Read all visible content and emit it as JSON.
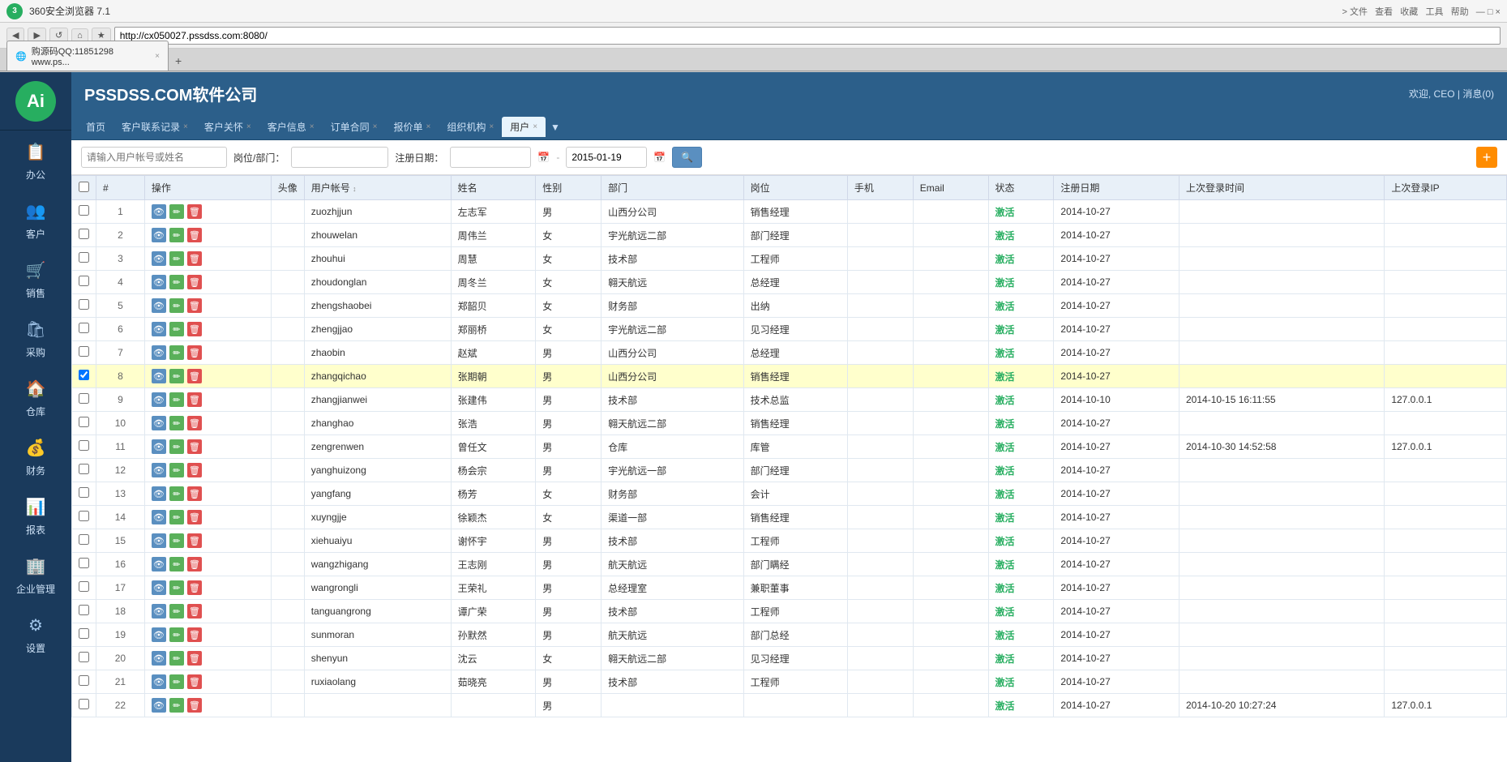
{
  "browser": {
    "title": "360安全浏览器 7.1",
    "tab_label": "购源码QQ:11851298 www.ps...",
    "address": "http://cx050027.pssdss.com:8080/",
    "nav_buttons": [
      "◀",
      "▶",
      "↺",
      "🏠",
      "★"
    ]
  },
  "header": {
    "company": "PSSDSS.COM软件公司",
    "welcome": "欢迎, CEO | 消息(0)"
  },
  "nav_tabs": [
    {
      "label": "首页",
      "closable": false
    },
    {
      "label": "客户联系记录",
      "closable": true
    },
    {
      "label": "客户关怀",
      "closable": true
    },
    {
      "label": "客户信息",
      "closable": true
    },
    {
      "label": "订单合同",
      "closable": true
    },
    {
      "label": "报价单",
      "closable": true
    },
    {
      "label": "组织机构",
      "closable": true
    },
    {
      "label": "用户",
      "closable": true,
      "active": true
    }
  ],
  "filters": {
    "search_placeholder": "请输入用户帐号或姓名",
    "position_label": "岗位/部门：",
    "position_placeholder": "",
    "reg_date_label": "注册日期：",
    "date_from": "",
    "date_to": "2015-01-19",
    "search_btn": "🔍",
    "add_btn": "+"
  },
  "table": {
    "columns": [
      "",
      "#",
      "操作",
      "头像",
      "用户帐号 ↕",
      "姓名",
      "性别",
      "部门",
      "岗位",
      "手机",
      "Email",
      "状态",
      "注册日期",
      "上次登录时间",
      "上次登录IP"
    ],
    "rows": [
      {
        "num": 1,
        "checked": false,
        "username": "zuozhjjun",
        "name": "左志军",
        "gender": "男",
        "dept": "山西分公司",
        "pos": "销售经理",
        "mobile": "",
        "email": "",
        "status": "激活",
        "reg_date": "2014-10-27",
        "last_login": "",
        "last_ip": "",
        "highlighted": false
      },
      {
        "num": 2,
        "checked": false,
        "username": "zhouwelan",
        "name": "周伟兰",
        "gender": "女",
        "dept": "宇光航远二部",
        "pos": "部门经理",
        "mobile": "",
        "email": "",
        "status": "激活",
        "reg_date": "2014-10-27",
        "last_login": "",
        "last_ip": "",
        "highlighted": false
      },
      {
        "num": 3,
        "checked": false,
        "username": "zhouhui",
        "name": "周慧",
        "gender": "女",
        "dept": "技术部",
        "pos": "工程师",
        "mobile": "",
        "email": "",
        "status": "激活",
        "reg_date": "2014-10-27",
        "last_login": "",
        "last_ip": "",
        "highlighted": false
      },
      {
        "num": 4,
        "checked": false,
        "username": "zhoudonglan",
        "name": "周冬兰",
        "gender": "女",
        "dept": "翱天航远",
        "pos": "总经理",
        "mobile": "",
        "email": "",
        "status": "激活",
        "reg_date": "2014-10-27",
        "last_login": "",
        "last_ip": "",
        "highlighted": false
      },
      {
        "num": 5,
        "checked": false,
        "username": "zhengshaobei",
        "name": "郑韶贝",
        "gender": "女",
        "dept": "财务部",
        "pos": "出纳",
        "mobile": "",
        "email": "",
        "status": "激活",
        "reg_date": "2014-10-27",
        "last_login": "",
        "last_ip": "",
        "highlighted": false
      },
      {
        "num": 6,
        "checked": false,
        "username": "zhengjjao",
        "name": "郑丽桥",
        "gender": "女",
        "dept": "宇光航远二部",
        "pos": "见习经理",
        "mobile": "",
        "email": "",
        "status": "激活",
        "reg_date": "2014-10-27",
        "last_login": "",
        "last_ip": "",
        "highlighted": false
      },
      {
        "num": 7,
        "checked": false,
        "username": "zhaobin",
        "name": "赵斌",
        "gender": "男",
        "dept": "山西分公司",
        "pos": "总经理",
        "mobile": "",
        "email": "",
        "status": "激活",
        "reg_date": "2014-10-27",
        "last_login": "",
        "last_ip": "",
        "highlighted": false
      },
      {
        "num": 8,
        "checked": true,
        "username": "zhangqichao",
        "name": "张期朝",
        "gender": "男",
        "dept": "山西分公司",
        "pos": "销售经理",
        "mobile": "",
        "email": "",
        "status": "激活",
        "reg_date": "2014-10-27",
        "last_login": "",
        "last_ip": "",
        "highlighted": true
      },
      {
        "num": 9,
        "checked": false,
        "username": "zhangjianwei",
        "name": "张建伟",
        "gender": "男",
        "dept": "技术部",
        "pos": "技术总监",
        "mobile": "",
        "email": "",
        "status": "激活",
        "reg_date": "2014-10-10",
        "last_login": "2014-10-15 16:11:55",
        "last_ip": "127.0.0.1",
        "highlighted": false
      },
      {
        "num": 10,
        "checked": false,
        "username": "zhanghao",
        "name": "张浩",
        "gender": "男",
        "dept": "翱天航远二部",
        "pos": "销售经理",
        "mobile": "",
        "email": "",
        "status": "激活",
        "reg_date": "2014-10-27",
        "last_login": "",
        "last_ip": "",
        "highlighted": false
      },
      {
        "num": 11,
        "checked": false,
        "username": "zengrenwen",
        "name": "曾任文",
        "gender": "男",
        "dept": "仓库",
        "pos": "库管",
        "mobile": "",
        "email": "",
        "status": "激活",
        "reg_date": "2014-10-27",
        "last_login": "2014-10-30 14:52:58",
        "last_ip": "127.0.0.1",
        "highlighted": false
      },
      {
        "num": 12,
        "checked": false,
        "username": "yanghuizong",
        "name": "杨会宗",
        "gender": "男",
        "dept": "宇光航远一部",
        "pos": "部门经理",
        "mobile": "",
        "email": "",
        "status": "激活",
        "reg_date": "2014-10-27",
        "last_login": "",
        "last_ip": "",
        "highlighted": false
      },
      {
        "num": 13,
        "checked": false,
        "username": "yangfang",
        "name": "杨芳",
        "gender": "女",
        "dept": "财务部",
        "pos": "会计",
        "mobile": "",
        "email": "",
        "status": "激活",
        "reg_date": "2014-10-27",
        "last_login": "",
        "last_ip": "",
        "highlighted": false
      },
      {
        "num": 14,
        "checked": false,
        "username": "xuyngjje",
        "name": "徐颖杰",
        "gender": "女",
        "dept": "渠道一部",
        "pos": "销售经理",
        "mobile": "",
        "email": "",
        "status": "激活",
        "reg_date": "2014-10-27",
        "last_login": "",
        "last_ip": "",
        "highlighted": false
      },
      {
        "num": 15,
        "checked": false,
        "username": "xiehuaiyu",
        "name": "谢怀宇",
        "gender": "男",
        "dept": "技术部",
        "pos": "工程师",
        "mobile": "",
        "email": "",
        "status": "激活",
        "reg_date": "2014-10-27",
        "last_login": "",
        "last_ip": "",
        "highlighted": false
      },
      {
        "num": 16,
        "checked": false,
        "username": "wangzhigang",
        "name": "王志刚",
        "gender": "男",
        "dept": "航天航远",
        "pos": "部门瞒经",
        "mobile": "",
        "email": "",
        "status": "激活",
        "reg_date": "2014-10-27",
        "last_login": "",
        "last_ip": "",
        "highlighted": false
      },
      {
        "num": 17,
        "checked": false,
        "username": "wangrongli",
        "name": "王荣礼",
        "gender": "男",
        "dept": "总经理室",
        "pos": "兼职董事",
        "mobile": "",
        "email": "",
        "status": "激活",
        "reg_date": "2014-10-27",
        "last_login": "",
        "last_ip": "",
        "highlighted": false
      },
      {
        "num": 18,
        "checked": false,
        "username": "tanguangrong",
        "name": "谭广荣",
        "gender": "男",
        "dept": "技术部",
        "pos": "工程师",
        "mobile": "",
        "email": "",
        "status": "激活",
        "reg_date": "2014-10-27",
        "last_login": "",
        "last_ip": "",
        "highlighted": false
      },
      {
        "num": 19,
        "checked": false,
        "username": "sunmoran",
        "name": "孙默然",
        "gender": "男",
        "dept": "航天航远",
        "pos": "部门总经",
        "mobile": "",
        "email": "",
        "status": "激活",
        "reg_date": "2014-10-27",
        "last_login": "",
        "last_ip": "",
        "highlighted": false
      },
      {
        "num": 20,
        "checked": false,
        "username": "shenyun",
        "name": "沈云",
        "gender": "女",
        "dept": "翱天航远二部",
        "pos": "见习经理",
        "mobile": "",
        "email": "",
        "status": "激活",
        "reg_date": "2014-10-27",
        "last_login": "",
        "last_ip": "",
        "highlighted": false
      },
      {
        "num": 21,
        "checked": false,
        "username": "ruxiaolang",
        "name": "茹晓亮",
        "gender": "男",
        "dept": "技术部",
        "pos": "工程师",
        "mobile": "",
        "email": "",
        "status": "激活",
        "reg_date": "2014-10-27",
        "last_login": "",
        "last_ip": "",
        "highlighted": false
      },
      {
        "num": 22,
        "checked": false,
        "username": "",
        "name": "",
        "gender": "男",
        "dept": "",
        "pos": "",
        "mobile": "",
        "email": "",
        "status": "激活",
        "reg_date": "2014-10-27",
        "last_login": "2014-10-20 10:27:24",
        "last_ip": "127.0.0.1",
        "highlighted": false
      }
    ]
  },
  "sidebar": {
    "logo_text": "A",
    "items": [
      {
        "label": "办公",
        "icon": "📋"
      },
      {
        "label": "客户",
        "icon": "👥"
      },
      {
        "label": "销售",
        "icon": "🛒"
      },
      {
        "label": "采购",
        "icon": "🛍"
      },
      {
        "label": "仓库",
        "icon": "🏠"
      },
      {
        "label": "财务",
        "icon": "💰"
      },
      {
        "label": "报表",
        "icon": "📊"
      },
      {
        "label": "企业管理",
        "icon": "🏢"
      },
      {
        "label": "设置",
        "icon": "⚙"
      }
    ]
  }
}
